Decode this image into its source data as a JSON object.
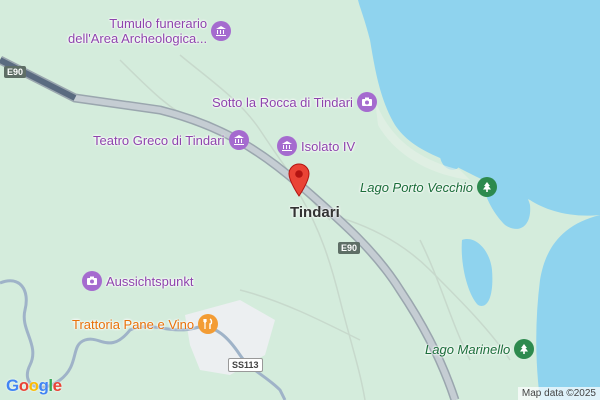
{
  "map": {
    "town_label": "Tindari",
    "pois": [
      {
        "id": "tumulo",
        "label_line1": "Tumulo funerario",
        "label_line2": "dell'Area Archeologica...",
        "kind": "museum",
        "color": "purple"
      },
      {
        "id": "sotto-la-rocca",
        "label": "Sotto la Rocca di Tindari",
        "kind": "camera",
        "color": "purple"
      },
      {
        "id": "teatro-greco",
        "label": "Teatro Greco di Tindari",
        "kind": "museum",
        "color": "purple"
      },
      {
        "id": "isolato-iv",
        "label": "Isolato IV",
        "kind": "museum",
        "color": "purple"
      },
      {
        "id": "aussichtspunkt",
        "label": "Aussichtspunkt",
        "kind": "camera",
        "color": "purple"
      },
      {
        "id": "trattoria",
        "label": "Trattoria Pane e Vino",
        "kind": "restaurant",
        "color": "orange"
      },
      {
        "id": "lago-porto-vecchio",
        "label": "Lago Porto Vecchio",
        "kind": "park",
        "color": "green"
      },
      {
        "id": "lago-marinello",
        "label": "Lago Marinello",
        "kind": "park",
        "color": "green"
      }
    ],
    "road_shields": [
      {
        "id": "e90-a",
        "label": "E90"
      },
      {
        "id": "e90-b",
        "label": "E90"
      },
      {
        "id": "ss113",
        "label": "SS113"
      }
    ],
    "attribution": "Map data ©2025",
    "logo": "Google",
    "colors": {
      "land": "#d4ecdc",
      "water": "#8fd3ee",
      "highway": "#b8c2c9",
      "poi_purple": "#a56bcf",
      "poi_orange": "#f39c34",
      "poi_green": "#2d8a4e",
      "marker": "#ea4335"
    }
  }
}
